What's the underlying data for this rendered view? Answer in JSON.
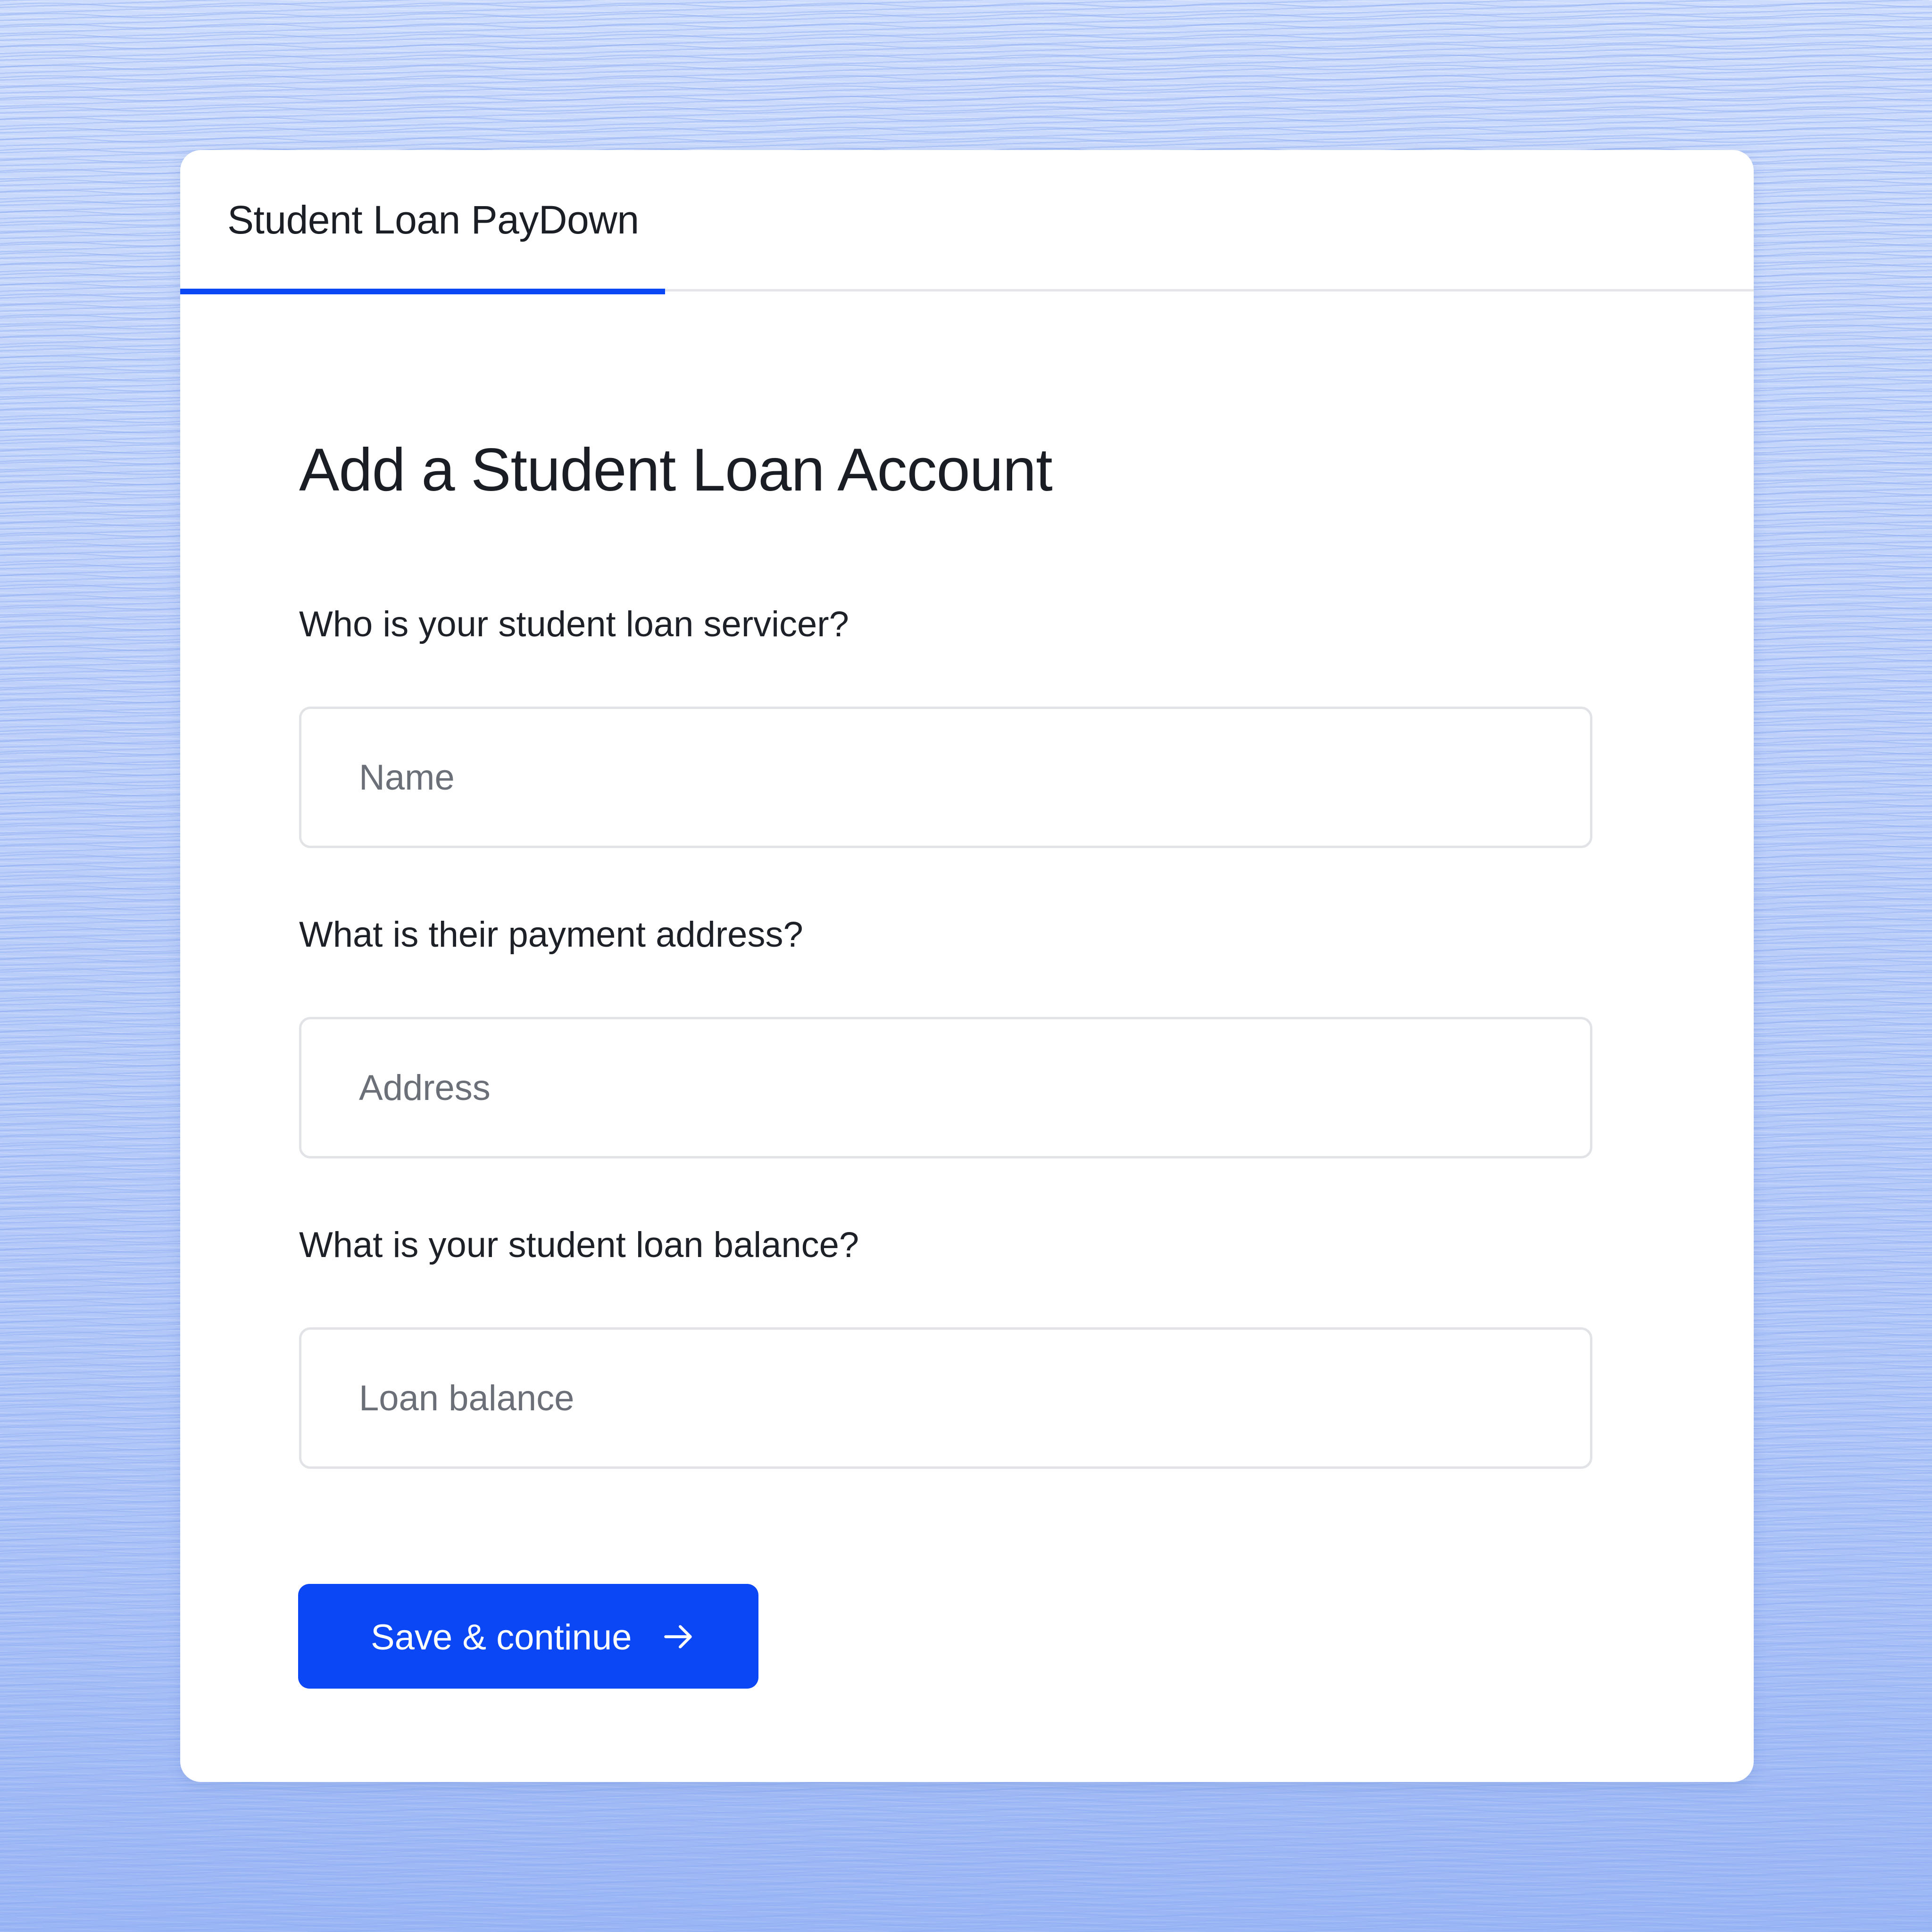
{
  "app": {
    "tab_label": "Student Loan PayDown"
  },
  "form": {
    "title": "Add a Student Loan Account",
    "fields": [
      {
        "label": "Who is your student loan servicer?",
        "placeholder": "Name",
        "value": ""
      },
      {
        "label": "What is their payment address?",
        "placeholder": "Address",
        "value": ""
      },
      {
        "label": "What is your student loan balance?",
        "placeholder": "Loan balance",
        "value": ""
      }
    ],
    "submit_label": "Save & continue",
    "submit_icon": "arrow-right-icon"
  },
  "colors": {
    "accent": "#0c47f5",
    "background": "#c9d8fb",
    "card": "#ffffff",
    "text": "#1d2026",
    "placeholder": "#6b6f78",
    "border": "#e1e3e7"
  }
}
